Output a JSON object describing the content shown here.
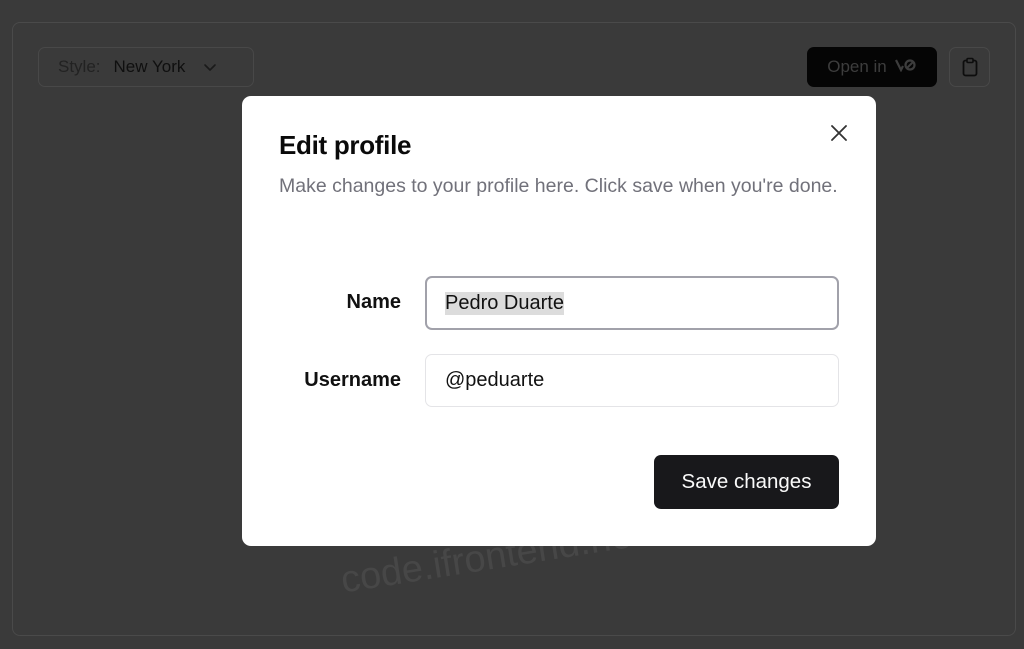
{
  "toolbar": {
    "style_label": "Style:",
    "style_value": "New York",
    "open_in_label": "Open in",
    "open_in_brand": "v0"
  },
  "watermark": "code.ifrontend.net",
  "dialog": {
    "title": "Edit profile",
    "description": "Make changes to your profile here. Click save when you're done.",
    "fields": {
      "name": {
        "label": "Name",
        "value": "Pedro Duarte"
      },
      "username": {
        "label": "Username",
        "value": "@peduarte"
      }
    },
    "save_label": "Save changes"
  },
  "icons": {
    "close": "close-icon",
    "chevron": "chevron-down-icon",
    "clipboard": "clipboard-icon"
  }
}
